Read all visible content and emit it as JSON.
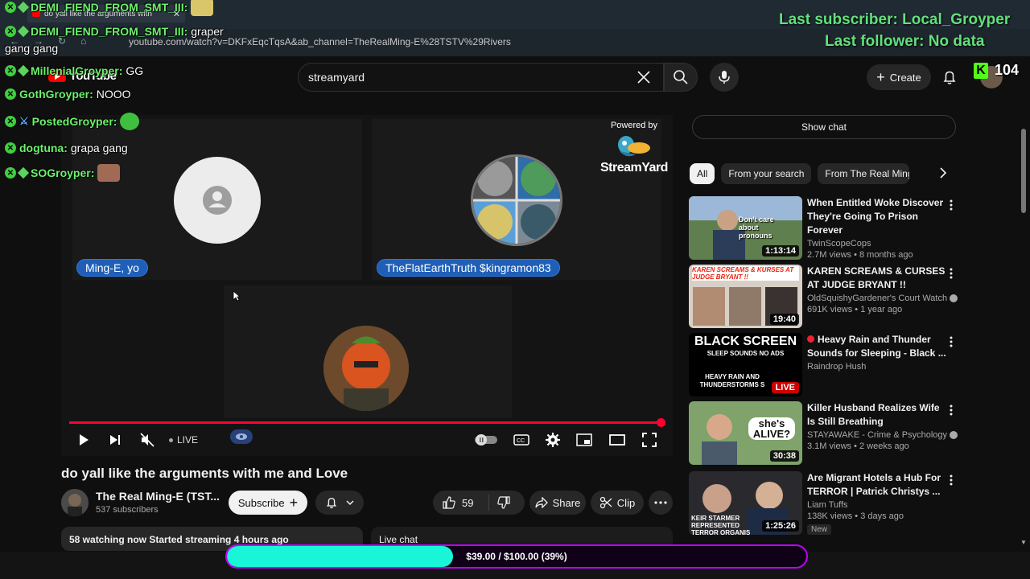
{
  "browser": {
    "tab_title": "do yall like the arguments with",
    "url": "youtube.com/watch?v=DKFxEqcTqsA&ab_channel=TheRealMing-E%28TSTV%29Rivers"
  },
  "youtube": {
    "logo_text": "YouTube",
    "search_value": "streamyard",
    "create_label": "Create"
  },
  "stream": {
    "participant1": "Ming-E, yo",
    "participant2": "TheFlatEarthTruth $kingramon83",
    "powered_by": "Powered by",
    "brand": "StreamYard",
    "live_label": "LIVE",
    "progress_percent": 100
  },
  "video": {
    "title": "do yall like the arguments with me and Love",
    "channel_name": "The Real Ming-E (TST...",
    "subscribers": "537 subscribers",
    "subscribe_label": "Subscribe",
    "likes": "59",
    "share_label": "Share",
    "clip_label": "Clip",
    "watching": "58 watching now",
    "started": "Started streaming 4 hours ago",
    "live_chat_label": "Live chat"
  },
  "sidebar": {
    "show_chat": "Show chat",
    "chips": [
      "All",
      "From your search",
      "From The Real Ming-E ("
    ],
    "recs": [
      {
        "title": "When Entitled Woke Discover They're Going To Prison Forever",
        "channel": "TwinScopeCops",
        "meta": "2.7M views • 8 months ago",
        "duration": "1:13:14",
        "thumb_text": "Don't care about pronouns"
      },
      {
        "title": "KAREN SCREAMS & CURSES AT JUDGE BRYANT !!",
        "channel": "OldSquishyGardener's Court Watch",
        "meta": "691K views • 1 year ago",
        "duration": "19:40",
        "thumb_text": "KAREN SCREAMS & KURSES AT JUDGE BRYANT !!"
      },
      {
        "title": "Heavy Rain and Thunder Sounds for Sleeping - Black ...",
        "channel": "Raindrop Hush",
        "meta": "",
        "duration": "LIVE",
        "thumb_text": "BLACK SCREEN",
        "thumb_sub": "SLEEP SOUNDS NO ADS",
        "thumb_sub2": "HEAVY RAIN AND THUNDERSTORMS S"
      },
      {
        "title": "Killer Husband Realizes Wife Is Still Breathing",
        "channel": "STAYAWAKE - Crime & Psychology",
        "meta": "3.1M views • 2 weeks ago",
        "duration": "30:38",
        "thumb_text": "she's ALIVE?"
      },
      {
        "title": "Are Migrant Hotels a Hub For TERROR | Patrick Christys ...",
        "channel": "Liam Tuffs",
        "meta": "138K views • 3 days ago",
        "duration": "1:25:26",
        "badge": "New",
        "thumb_text": "KEIR STARMER REPRESENTED TERROR ORGANIS"
      }
    ]
  },
  "overlay": {
    "chat": [
      {
        "user": "DEMI_FIEND_FROM_SMT_III:",
        "msg": "",
        "emote": true
      },
      {
        "user": "DEMI_FIEND_FROM_SMT_III:",
        "msg": "graper"
      },
      {
        "user": "",
        "msg": "gang gang"
      },
      {
        "user": "MillenialGroyper:",
        "msg": "GG"
      },
      {
        "user": "GothGroyper:",
        "msg": "NOOO"
      },
      {
        "user": "PostedGroyper:",
        "msg": "",
        "emote": true
      },
      {
        "user": "dogtuna:",
        "msg": "grapa gang"
      },
      {
        "user": "SOGroyper:",
        "msg": "",
        "emote": true
      }
    ],
    "last_subscriber": "Last subscriber: Local_Groyper",
    "last_follower": "Last follower: No data",
    "viewers": "104"
  },
  "goal": {
    "text": "$39.00 / $100.00 (39%)",
    "percent": 39
  },
  "colors": {
    "overlay_green": "#62e07a",
    "goal_fill": "#19f5d8",
    "goal_border": "#c000ff",
    "yt_red": "#ff0000"
  }
}
